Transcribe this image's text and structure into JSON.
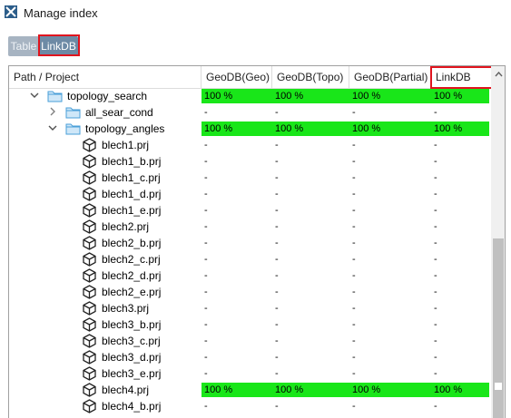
{
  "window": {
    "title": "Manage index",
    "icon": "tools-icon"
  },
  "toggle": {
    "table_label": "Table",
    "linkdb_label": "LinkDB",
    "selected": "LinkDB"
  },
  "columns": [
    "Path / Project",
    "GeoDB(Geo)",
    "GeoDB(Topo)",
    "GeoDB(Partial)",
    "LinkDB"
  ],
  "colors": {
    "full_index": "#19e619",
    "highlight": "#e0141e",
    "folder": "#4a9fd8"
  },
  "rows": [
    {
      "name": "topology_search",
      "type": "folder",
      "level": 0,
      "expander": "expanded",
      "values": [
        "100 %",
        "100 %",
        "100 %",
        "100 %"
      ]
    },
    {
      "name": "all_sear_cond",
      "type": "folder",
      "level": 1,
      "expander": "collapsed",
      "values": [
        "-",
        "-",
        "-",
        "-"
      ]
    },
    {
      "name": "topology_angles",
      "type": "folder",
      "level": 1,
      "expander": "expanded",
      "values": [
        "100 %",
        "100 %",
        "100 %",
        "100 %"
      ]
    },
    {
      "name": "blech1.prj",
      "type": "project",
      "level": 2,
      "values": [
        "-",
        "-",
        "-",
        "-"
      ]
    },
    {
      "name": "blech1_b.prj",
      "type": "project",
      "level": 2,
      "values": [
        "-",
        "-",
        "-",
        "-"
      ]
    },
    {
      "name": "blech1_c.prj",
      "type": "project",
      "level": 2,
      "values": [
        "-",
        "-",
        "-",
        "-"
      ]
    },
    {
      "name": "blech1_d.prj",
      "type": "project",
      "level": 2,
      "values": [
        "-",
        "-",
        "-",
        "-"
      ]
    },
    {
      "name": "blech1_e.prj",
      "type": "project",
      "level": 2,
      "values": [
        "-",
        "-",
        "-",
        "-"
      ]
    },
    {
      "name": "blech2.prj",
      "type": "project",
      "level": 2,
      "values": [
        "-",
        "-",
        "-",
        "-"
      ]
    },
    {
      "name": "blech2_b.prj",
      "type": "project",
      "level": 2,
      "values": [
        "-",
        "-",
        "-",
        "-"
      ]
    },
    {
      "name": "blech2_c.prj",
      "type": "project",
      "level": 2,
      "values": [
        "-",
        "-",
        "-",
        "-"
      ]
    },
    {
      "name": "blech2_d.prj",
      "type": "project",
      "level": 2,
      "values": [
        "-",
        "-",
        "-",
        "-"
      ]
    },
    {
      "name": "blech2_e.prj",
      "type": "project",
      "level": 2,
      "values": [
        "-",
        "-",
        "-",
        "-"
      ]
    },
    {
      "name": "blech3.prj",
      "type": "project",
      "level": 2,
      "values": [
        "-",
        "-",
        "-",
        "-"
      ]
    },
    {
      "name": "blech3_b.prj",
      "type": "project",
      "level": 2,
      "values": [
        "-",
        "-",
        "-",
        "-"
      ]
    },
    {
      "name": "blech3_c.prj",
      "type": "project",
      "level": 2,
      "values": [
        "-",
        "-",
        "-",
        "-"
      ]
    },
    {
      "name": "blech3_d.prj",
      "type": "project",
      "level": 2,
      "values": [
        "-",
        "-",
        "-",
        "-"
      ]
    },
    {
      "name": "blech3_e.prj",
      "type": "project",
      "level": 2,
      "values": [
        "-",
        "-",
        "-",
        "-"
      ]
    },
    {
      "name": "blech4.prj",
      "type": "project",
      "level": 2,
      "values": [
        "100 %",
        "100 %",
        "100 %",
        "100 %"
      ]
    },
    {
      "name": "blech4_b.prj",
      "type": "project",
      "level": 2,
      "values": [
        "-",
        "-",
        "-",
        "-"
      ]
    }
  ]
}
